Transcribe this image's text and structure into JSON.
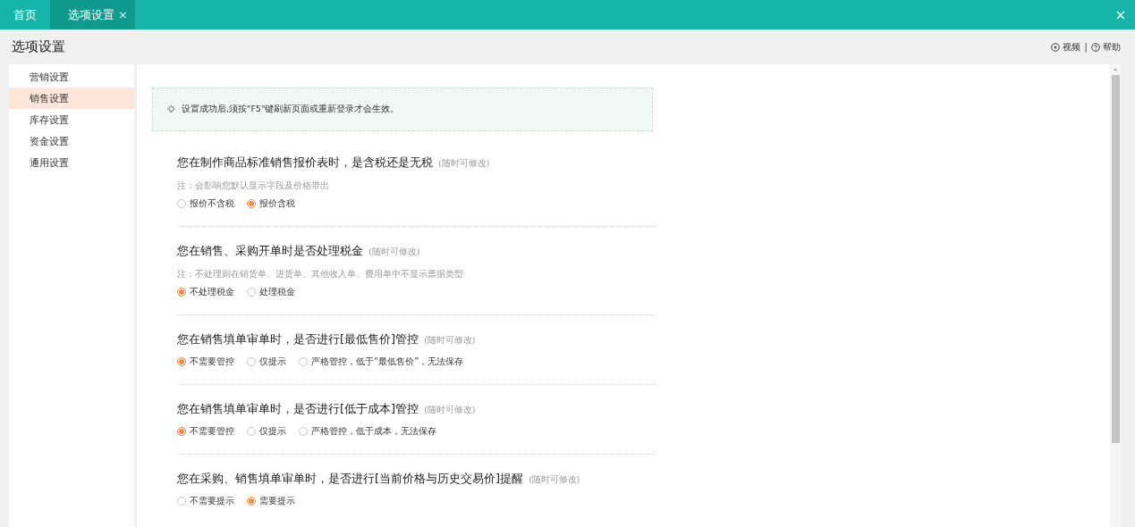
{
  "tabs": [
    {
      "label": "首页",
      "selected": false
    },
    {
      "label": "选项设置",
      "selected": true,
      "close": "×"
    }
  ],
  "window_close": "×",
  "header": {
    "title": "选项设置",
    "links": [
      {
        "kind": "video",
        "label": "视频"
      },
      {
        "kind": "help",
        "label": "帮助"
      }
    ],
    "separator": "|"
  },
  "sidebar": {
    "items": [
      {
        "label": "营销设置",
        "selected": false
      },
      {
        "label": "销售设置",
        "selected": true
      },
      {
        "label": "库存设置",
        "selected": false
      },
      {
        "label": "资金设置",
        "selected": false
      },
      {
        "label": "通用设置",
        "selected": false
      }
    ]
  },
  "notice": "设置成功后,须按\"F5\"键刷新页面或重新登录才会生效。",
  "sections": [
    {
      "title": "您在制作商品标准销售报价表时，是含税还是无税",
      "hint": "(随时可修改)",
      "note": "注：会影响您默认显示字段及价格带出",
      "options": [
        {
          "label": "报价不含税",
          "selected": false
        },
        {
          "label": "报价含税",
          "selected": true
        }
      ]
    },
    {
      "title": "您在销售、采购开单时是否处理税金",
      "hint": "(随时可修改)",
      "note": "注：不处理则在销货单、进货单、其他收入单、费用单中不显示票据类型",
      "options": [
        {
          "label": "不处理税金",
          "selected": true
        },
        {
          "label": "处理税金",
          "selected": false
        }
      ]
    },
    {
      "title": "您在销售填单审单时，是否进行[最低售价]管控",
      "hint": "(随时可修改)",
      "options": [
        {
          "label": "不需要管控",
          "selected": true
        },
        {
          "label": "仅提示",
          "selected": false
        },
        {
          "label": "严格管控，低于“最低售价”，无法保存",
          "selected": false
        }
      ]
    },
    {
      "title": "您在销售填单审单时，是否进行[低于成本]管控",
      "hint": "(随时可修改)",
      "options": [
        {
          "label": "不需要管控",
          "selected": true
        },
        {
          "label": "仅提示",
          "selected": false
        },
        {
          "label": "严格管控，低于成本，无法保存",
          "selected": false
        }
      ]
    },
    {
      "title": "您在采购、销售填单审单时，是否进行[当前价格与历史交易价]提醒",
      "hint": "(随时可修改)",
      "options": [
        {
          "label": "不需要提示",
          "selected": false
        },
        {
          "label": "需要提示",
          "selected": true
        }
      ]
    }
  ]
}
